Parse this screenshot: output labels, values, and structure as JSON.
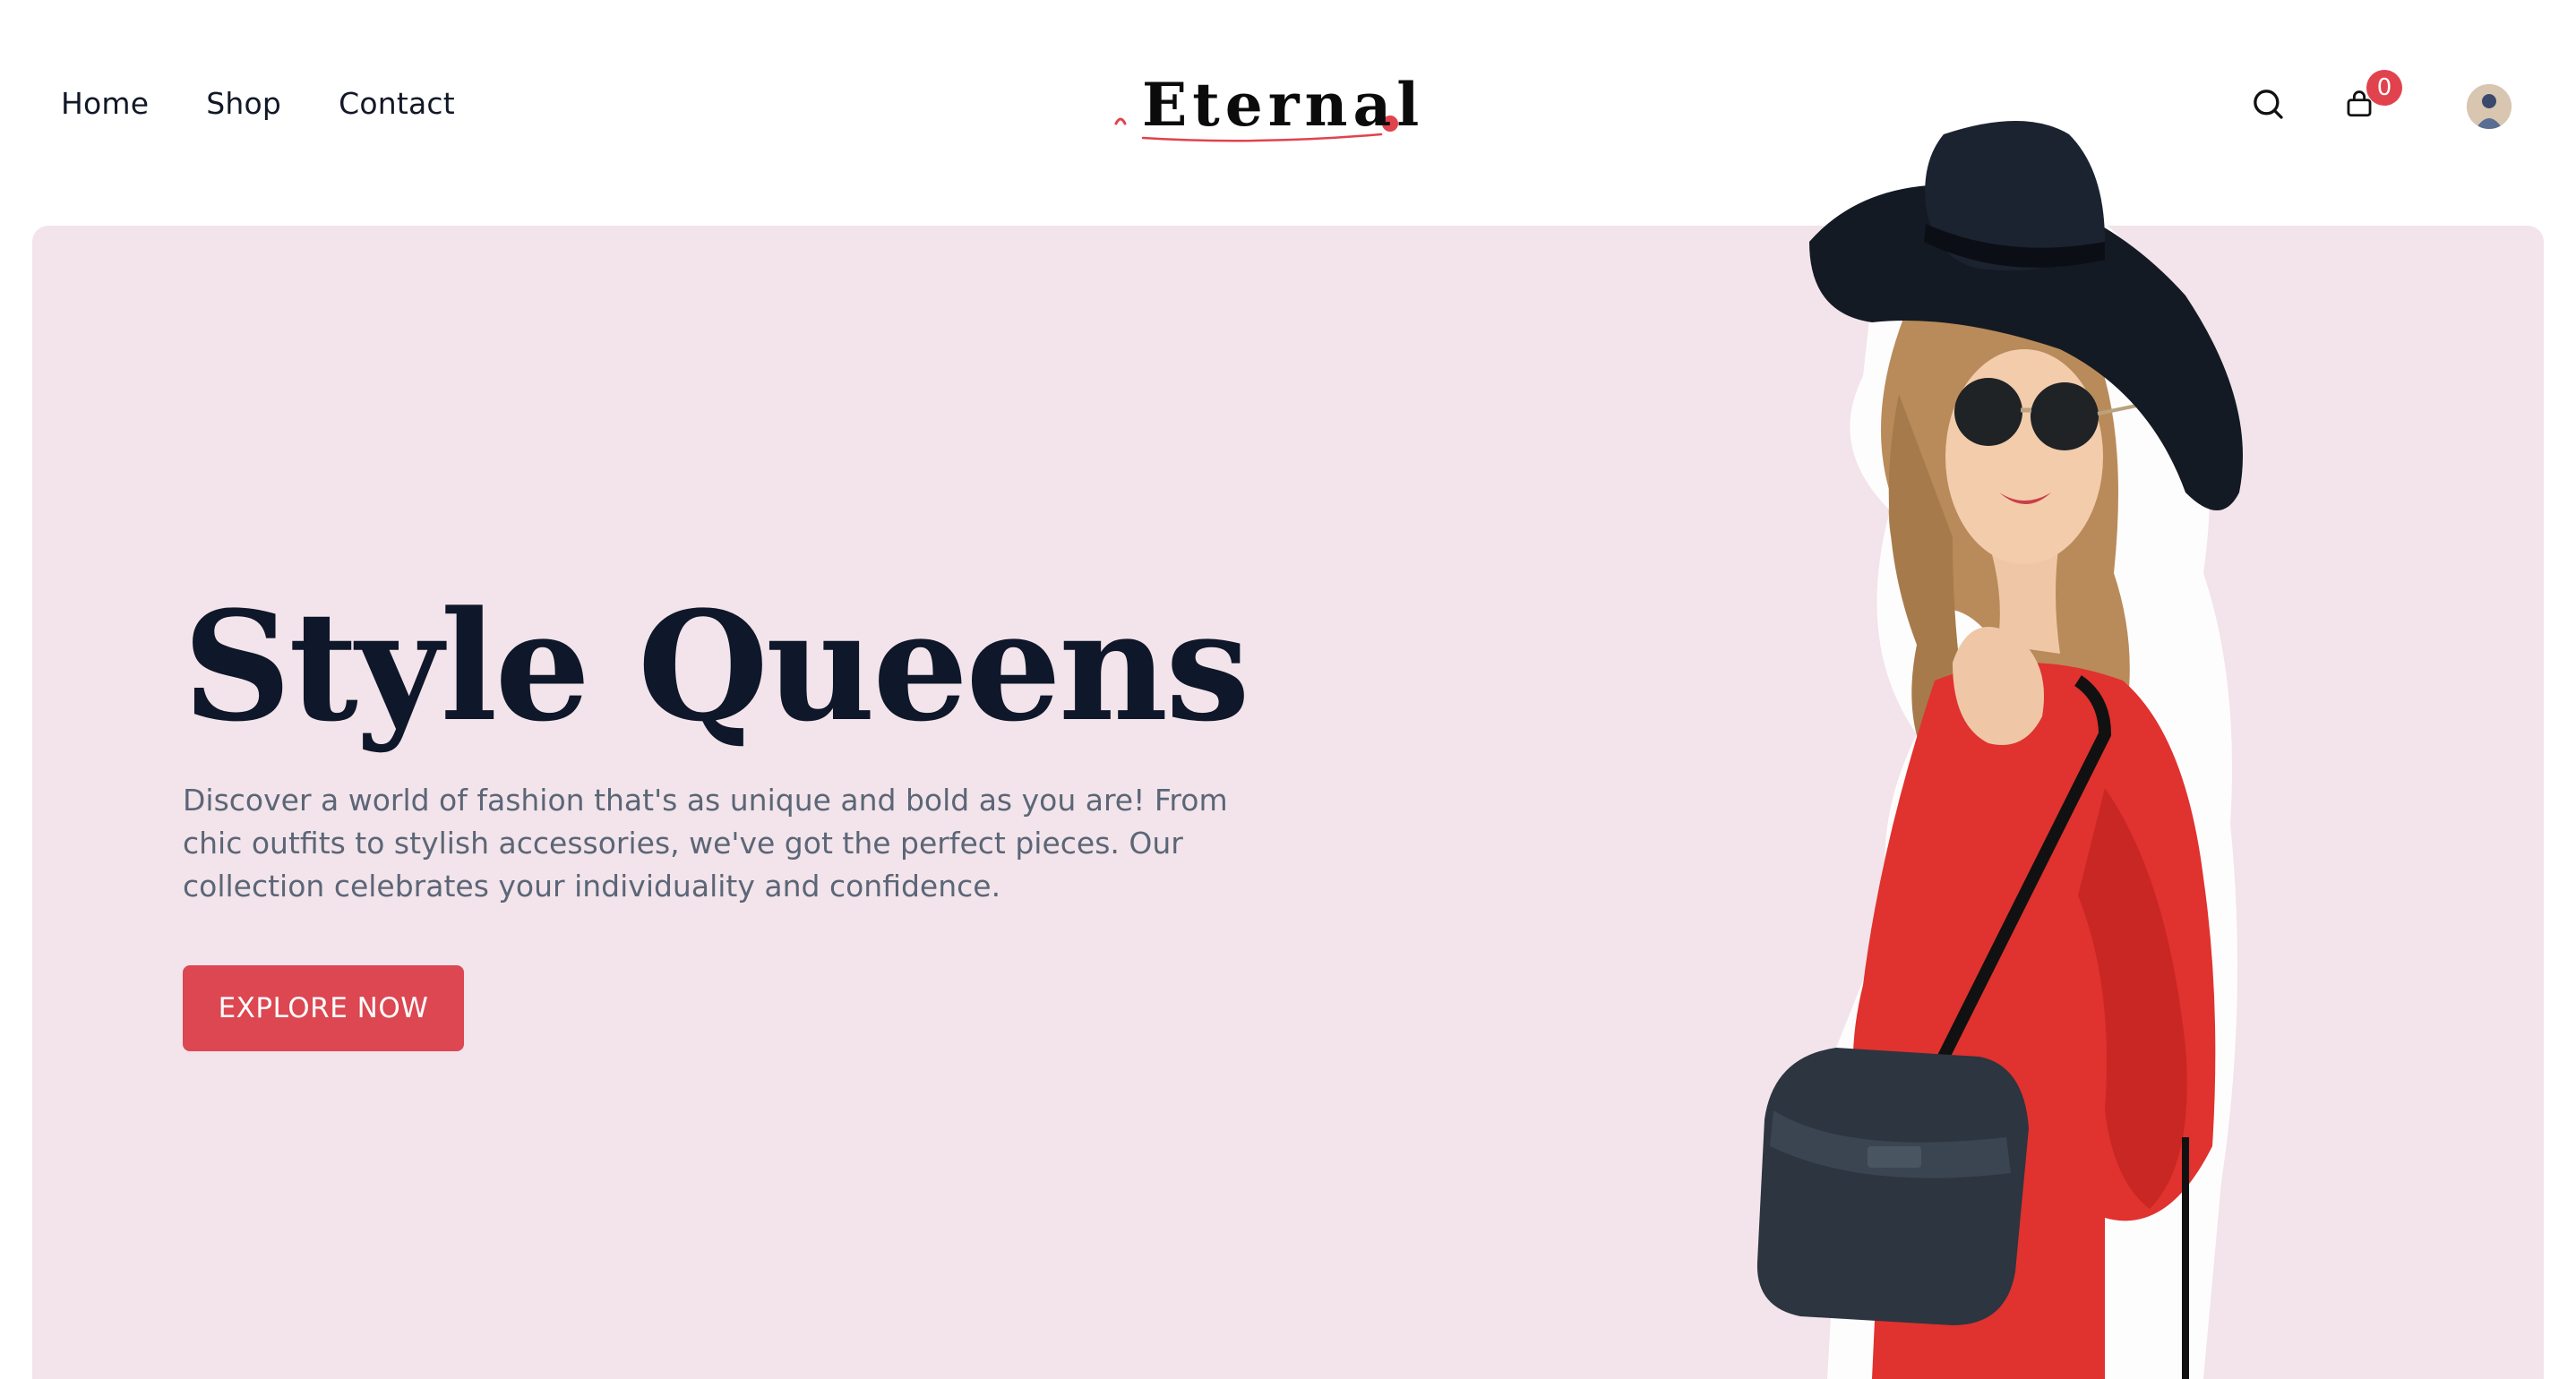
{
  "nav": {
    "items": [
      {
        "label": "Home"
      },
      {
        "label": "Shop"
      },
      {
        "label": "Contact"
      }
    ]
  },
  "brand": {
    "name": "Eternal",
    "accent": "#e0434e"
  },
  "header_icons": {
    "search_icon": "search-icon",
    "cart_icon": "shopping-bag-icon",
    "cart_count": "0"
  },
  "hero": {
    "title": "Style Queens",
    "description": "Discover a world of fashion that's as unique and bold as you are! From chic outfits to stylish accessories, we've got the perfect pieces. Our collection celebrates your individuality and confidence.",
    "cta_label": "EXPLORE NOW",
    "background": "#f2e4ea",
    "cta_color": "#dc4751"
  }
}
